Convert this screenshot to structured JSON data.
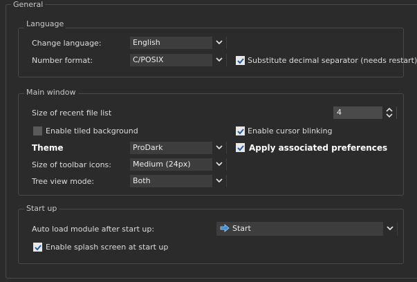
{
  "general": {
    "title": "General",
    "language": {
      "title": "Language",
      "change_language_label": "Change language:",
      "change_language_value": "English",
      "number_format_label": "Number format:",
      "number_format_value": "C/POSIX",
      "substitute_label": "Substitute decimal separator (needs restart)",
      "substitute_checked": true
    },
    "main_window": {
      "title": "Main window",
      "recent_files_label": "Size of recent file list",
      "recent_files_value": "4",
      "tiled_bg_label": "Enable tiled background",
      "tiled_bg_checked": false,
      "cursor_blink_label": "Enable cursor blinking",
      "cursor_blink_checked": true,
      "theme_label": "Theme",
      "theme_value": "ProDark",
      "apply_prefs_label": "Apply associated preferences",
      "apply_prefs_checked": true,
      "toolbar_icons_label": "Size of toolbar icons:",
      "toolbar_icons_value": "Medium (24px)",
      "tree_view_label": "Tree view mode:",
      "tree_view_value": "Both"
    },
    "start_up": {
      "title": "Start up",
      "auto_load_label": "Auto load module after start up:",
      "auto_load_value": "Start",
      "splash_label": "Enable splash screen at start up",
      "splash_checked": true
    }
  },
  "colors": {
    "background": "#2b2b2b",
    "field": "#3d3d3d",
    "start_icon": "#3b8fd9"
  },
  "icons": [
    "chevron-down-icon",
    "spin-updown-icon",
    "check-icon",
    "arrow-right-icon"
  ]
}
